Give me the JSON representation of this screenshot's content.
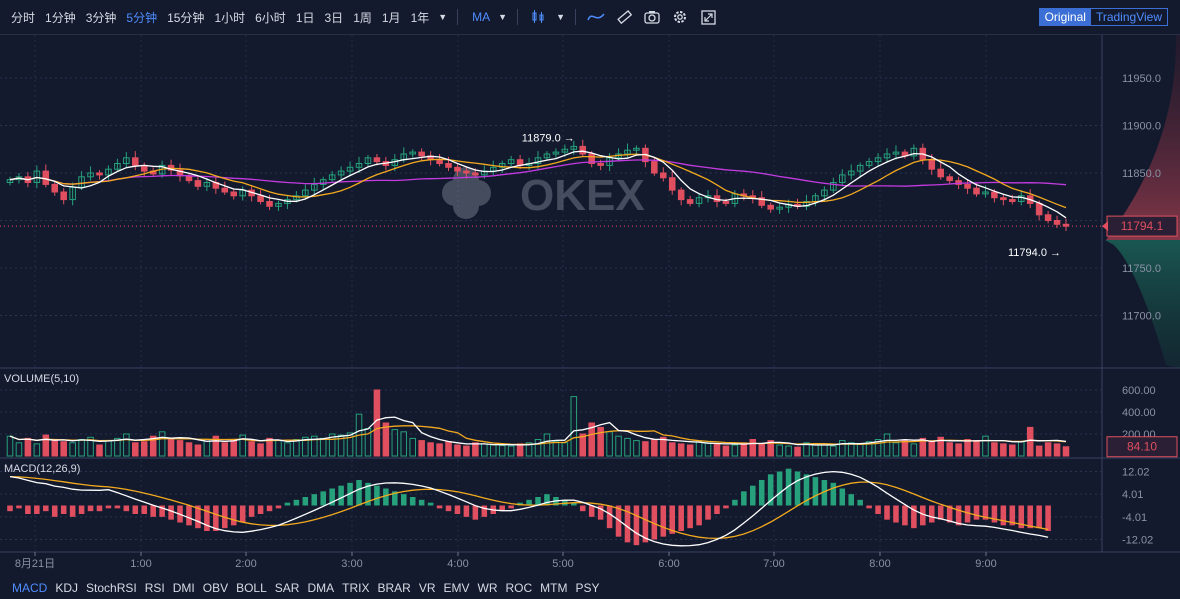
{
  "toolbar": {
    "timeframes": [
      "分时",
      "1分钟",
      "3分钟",
      "5分钟",
      "15分钟",
      "1小时",
      "6小时",
      "1日",
      "3日",
      "1周",
      "1月",
      "1年"
    ],
    "active_timeframe": "5分钟",
    "indicator": "MA",
    "view_original": "Original",
    "view_tradingview": "TradingView",
    "icons": [
      "chevron-down-icon",
      "candlestick-icon",
      "chevron-down-icon",
      "line-style-icon",
      "drawing-ruler-icon",
      "camera-icon",
      "gear-icon",
      "fullscreen-icon"
    ]
  },
  "watermark": "OKEX",
  "main_chart": {
    "y_ticks": [
      "11950.0",
      "11900.0",
      "11850.0",
      "11800.0",
      "11750.0",
      "11700.0"
    ],
    "current_price": "11794.1",
    "high_label": "11879.0",
    "low_label": "11794.0",
    "colors": {
      "up": "#26a17b",
      "down": "#e04f5f",
      "ma5": "#ffffff",
      "ma10": "#f2a91f",
      "ma30": "#c33be0"
    }
  },
  "volume_panel": {
    "title": "VOLUME(5,10)",
    "y_ticks": [
      "600.00",
      "400.00",
      "200.00"
    ],
    "current_value": "84.10"
  },
  "macd_panel": {
    "title": "MACD(12,26,9)",
    "y_ticks": [
      "12.02",
      "4.01",
      "-4.01",
      "-12.02"
    ]
  },
  "x_axis": {
    "labels": [
      "8月21日",
      "1:00",
      "2:00",
      "3:00",
      "4:00",
      "5:00",
      "6:00",
      "7:00",
      "8:00",
      "9:00"
    ]
  },
  "bottom_tabs": [
    "MACD",
    "KDJ",
    "StochRSI",
    "RSI",
    "DMI",
    "OBV",
    "BOLL",
    "SAR",
    "DMA",
    "TRIX",
    "BRAR",
    "VR",
    "EMV",
    "WR",
    "ROC",
    "MTM",
    "PSY"
  ],
  "active_bottom_tab": "MACD",
  "chart_data": {
    "type": "candlestick",
    "price_range": [
      11650,
      11990
    ],
    "closes": [
      11843,
      11846,
      11840,
      11852,
      11838,
      11830,
      11822,
      11835,
      11846,
      11850,
      11848,
      11854,
      11860,
      11866,
      11858,
      11852,
      11849,
      11858,
      11853,
      11847,
      11842,
      11836,
      11840,
      11834,
      11830,
      11826,
      11832,
      11826,
      11820,
      11815,
      11818,
      11822,
      11826,
      11832,
      11838,
      11843,
      11848,
      11852,
      11856,
      11860,
      11866,
      11862,
      11858,
      11864,
      11870,
      11872,
      11868,
      11864,
      11860,
      11856,
      11852,
      11850,
      11848,
      11852,
      11856,
      11860,
      11864,
      11858,
      11860,
      11866,
      11870,
      11872,
      11875,
      11878,
      11870,
      11860,
      11858,
      11866,
      11870,
      11874,
      11876,
      11862,
      11850,
      11845,
      11832,
      11822,
      11818,
      11824,
      11826,
      11820,
      11818,
      11828,
      11826,
      11824,
      11816,
      11812,
      11814,
      11817,
      11815,
      11820,
      11826,
      11832,
      11840,
      11848,
      11852,
      11858,
      11862,
      11866,
      11870,
      11872,
      11868,
      11876,
      11864,
      11854,
      11846,
      11842,
      11838,
      11834,
      11828,
      11830,
      11824,
      11822,
      11820,
      11826,
      11818,
      11806,
      11800,
      11796,
      11794
    ],
    "volume_range": [
      0,
      700
    ],
    "volumes": [
      180,
      120,
      160,
      110,
      190,
      140,
      130,
      120,
      150,
      170,
      100,
      140,
      160,
      200,
      120,
      130,
      180,
      220,
      160,
      140,
      120,
      100,
      150,
      180,
      120,
      140,
      190,
      130,
      110,
      160,
      140,
      120,
      150,
      170,
      180,
      160,
      200,
      190,
      210,
      380,
      250,
      600,
      300,
      240,
      220,
      160,
      140,
      120,
      110,
      130,
      100,
      90,
      120,
      110,
      100,
      95,
      90,
      110,
      120,
      150,
      200,
      130,
      120,
      540,
      200,
      300,
      260,
      220,
      180,
      160,
      140,
      130,
      150,
      170,
      120,
      110,
      100,
      130,
      120,
      110,
      90,
      100,
      120,
      150,
      110,
      140,
      100,
      90,
      80,
      120,
      110,
      100,
      90,
      140,
      120,
      110,
      130,
      150,
      200,
      120,
      140,
      110,
      160,
      130,
      170,
      120,
      110,
      150,
      140,
      180,
      120,
      110,
      100,
      130,
      260,
      90,
      120,
      110,
      84
    ],
    "macd_range": [
      -15,
      15
    ],
    "macd_hist": [
      -2,
      -1,
      -3,
      -3,
      -2,
      -4,
      -3,
      -4,
      -3,
      -2,
      -2,
      -1,
      -1,
      -2,
      -3,
      -3,
      -4,
      -4,
      -5,
      -6,
      -7,
      -8,
      -9,
      -9,
      -8,
      -7,
      -6,
      -4,
      -3,
      -2,
      -1,
      1,
      2,
      3,
      4,
      5,
      6,
      7,
      8,
      9,
      8,
      7,
      6,
      5,
      4,
      3,
      2,
      1,
      -1,
      -2,
      -3,
      -4,
      -5,
      -4,
      -3,
      -2,
      -1,
      1,
      2,
      3,
      4,
      3,
      2,
      1,
      -2,
      -4,
      -5,
      -8,
      -11,
      -13,
      -14,
      -13,
      -12,
      -11,
      -10,
      -9,
      -8,
      -7,
      -5,
      -3,
      -1,
      2,
      5,
      7,
      9,
      11,
      12,
      13,
      12,
      11,
      10,
      9,
      8,
      6,
      4,
      2,
      -1,
      -3,
      -5,
      -6,
      -7,
      -8,
      -7,
      -6,
      -5,
      -6,
      -7,
      -6,
      -5,
      -5,
      -6,
      -7,
      -7,
      -8,
      -8,
      -8,
      -9
    ]
  }
}
